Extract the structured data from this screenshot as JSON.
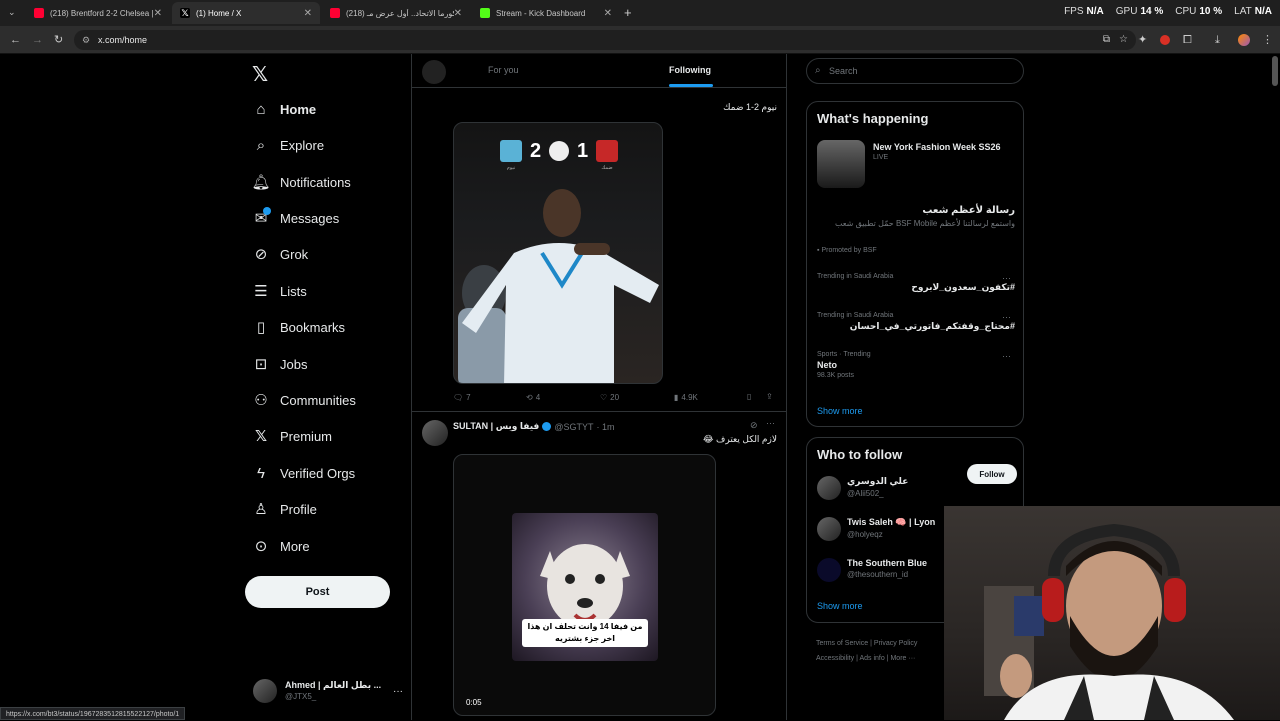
{
  "browser": {
    "tabs": [
      {
        "title": "(218) Brentford 2-2 Chelsea | H",
        "color": "#ff0033"
      },
      {
        "title": "(1) Home / X",
        "color": "#ffffff"
      },
      {
        "title": "(218) كورما الاتحاد.. أول عرض مـ",
        "color": "#ff0033"
      },
      {
        "title": "Stream - Kick Dashboard",
        "color": "#53fc18"
      }
    ],
    "perf": {
      "fps_label": "FPS",
      "fps": "N/A",
      "gpu_label": "GPU",
      "gpu": "14 %",
      "cpu_label": "CPU",
      "cpu": "10 %",
      "lat_label": "LAT",
      "lat": "N/A"
    },
    "url": "x.com/home",
    "status_url": "https://x.com/bt3/status/1967283512815522127/photo/1"
  },
  "nav": {
    "items": [
      {
        "label": "Home",
        "icon": "home-icon"
      },
      {
        "label": "Explore",
        "icon": "search-icon"
      },
      {
        "label": "Notifications",
        "icon": "bell-icon"
      },
      {
        "label": "Messages",
        "icon": "mail-icon"
      },
      {
        "label": "Grok",
        "icon": "grok-icon"
      },
      {
        "label": "Lists",
        "icon": "list-icon"
      },
      {
        "label": "Bookmarks",
        "icon": "bookmark-icon"
      },
      {
        "label": "Jobs",
        "icon": "briefcase-icon"
      },
      {
        "label": "Communities",
        "icon": "people-icon"
      },
      {
        "label": "Premium",
        "icon": "x-icon"
      },
      {
        "label": "Verified Orgs",
        "icon": "lightning-icon"
      },
      {
        "label": "Profile",
        "icon": "person-icon"
      },
      {
        "label": "More",
        "icon": "more-circle-icon"
      }
    ],
    "post_label": "Post",
    "account": {
      "name": "Ahmed | بطل العالم ...",
      "handle": "@JTX5_"
    }
  },
  "main": {
    "tabs": {
      "for_you": "For you",
      "following": "Following"
    },
    "post1": {
      "text": "نيوم 2-1 ضمك",
      "score_left": "2",
      "score_right": "1",
      "team_left": "نيوم",
      "team_right": "ضمك",
      "replies": "7",
      "reposts": "4",
      "likes": "20",
      "views": "4.9K"
    },
    "post2": {
      "name": "SULTAN | فيفا وبس",
      "handle": "@SGTYT",
      "time": "· 1m",
      "text": "لازم الكل يعترف 😂",
      "caption": "من فيفا 14 وانت تحلف ان هذا اخر جزء بشتريه",
      "duration": "0:05"
    }
  },
  "right": {
    "search_placeholder": "Search",
    "happening": {
      "title": "What's happening",
      "fashion": {
        "title": "New York Fashion Week SS26",
        "status": "LIVE"
      },
      "promo": {
        "title": "رسالة لأعظم شعب",
        "desc": "واستمع لرسالتنا لأعظم BSF Mobile حمّل تطبيق شعب",
        "promoted": "Promoted by BSF"
      },
      "trends": [
        {
          "context": "Trending in Saudi Arabia",
          "name": "#تكفون_سعدون_لابروح",
          "posts": ""
        },
        {
          "context": "Trending in Saudi Arabia",
          "name": "#محتاج_وقفتكم_فاتورتي_في_احسان",
          "posts": ""
        },
        {
          "context": "Sports · Trending",
          "name": "Neto",
          "posts": "98.3K posts"
        }
      ],
      "show_more": "Show more"
    },
    "who_to_follow": {
      "title": "Who to follow",
      "users": [
        {
          "name": "علي الدوسري",
          "handle": "@Alii502_"
        },
        {
          "name": "Twis Saleh 🧠 | Lyon",
          "handle": "@holyeqz"
        },
        {
          "name": "The Southern Blue",
          "handle": "@thesouthern_id"
        }
      ],
      "follow_label": "Follow",
      "show_more": "Show more"
    },
    "footer": {
      "terms": "Terms of Service",
      "privacy": "Privacy Policy",
      "accessibility": "Accessibility",
      "ads": "Ads info",
      "more": "More ···"
    }
  }
}
